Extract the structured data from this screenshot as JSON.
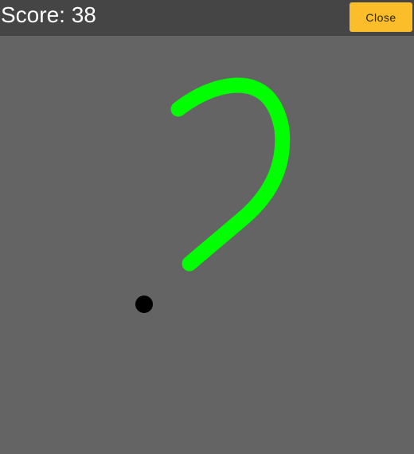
{
  "header": {
    "score_text": "Score: 38",
    "close_label": "Close"
  },
  "colors": {
    "board_background": "#646464",
    "header_background": "#454545",
    "close_button": "#fbbd2a",
    "snake": "#00ff00",
    "food": "#000000"
  }
}
